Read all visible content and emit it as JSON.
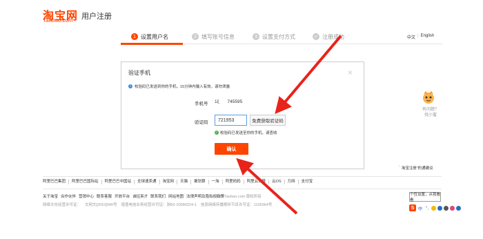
{
  "header": {
    "logo_cn": "淘宝网",
    "logo_en": "Taobao.com",
    "title": "用户注册"
  },
  "steps": [
    {
      "num": "1",
      "label": "设置用户名",
      "active": true
    },
    {
      "num": "2",
      "label": "填写账号信息",
      "active": false
    },
    {
      "num": "3",
      "label": "设置支付方式",
      "active": false
    },
    {
      "num": "✓",
      "label": "注册成功",
      "active": false
    }
  ],
  "language": {
    "cn": "中文",
    "sep": "|",
    "en": "English"
  },
  "dialog": {
    "title": "验证手机",
    "close": "×",
    "info_icon": "i",
    "info_text": "校验码已发送到你的手机，15分钟内输入有效，请勿泄露",
    "phone_label": "手机号",
    "phone_prefix": "1ξ",
    "phone_suffix": "745595",
    "code_label": "验证码",
    "code_value": "721953",
    "get_code_button": "免费获取验证码",
    "sent_icon": "✓",
    "sent_text": "校验码已发送至你的手机，请查收",
    "confirm_button": "确认"
  },
  "side": {
    "help_text_1": "有问题？",
    "help_text_2": "找小蜜",
    "privacy_tag": "“",
    "privacy_text": "淘宝注册”的通建议"
  },
  "footer": {
    "group_links": [
      "阿里巴巴集团",
      "阿里巴巴国际站",
      "阿里巴巴中国站",
      "全球速卖通",
      "淘宝网",
      "天猫",
      "聚划算",
      "一淘",
      "阿里妈妈",
      "阿里云计算",
      "云OS",
      "万网",
      "支付宝"
    ],
    "about_links": [
      "关于淘宝",
      "合作伙伴",
      "营销中心",
      "联系客服",
      "开放平台",
      "诚征英才",
      "联系我们",
      "网站地图",
      "法律声明及隐私权政策"
    ],
    "copyright": "© 2019 Taobao.com 版权所有",
    "licenses": [
      "网络文化经营许可证：",
      "文网文[2010]040号",
      "增值电信业务经营许可证：浙B2-20080224-1",
      "信息网络传播视听节目许可证：1109364号"
    ]
  },
  "ime": {
    "tip": "个性设置，点我看看",
    "s_label": "S",
    "cn_label": "中",
    "punct": "°,",
    "icons": [
      "emoji-icon",
      "mic-icon",
      "keyboard-icon",
      "skin-icon",
      "toolbox-icon"
    ]
  },
  "colors": {
    "brand": "#ff4400",
    "link_blue": "#3a8de0",
    "arrow": "#e8231a"
  }
}
